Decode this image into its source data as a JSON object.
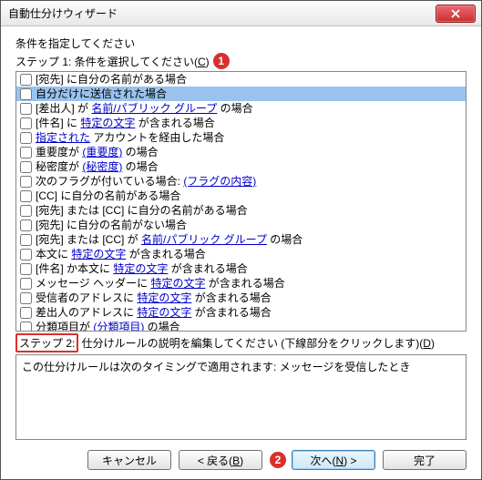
{
  "window": {
    "title": "自動仕分けウィザード"
  },
  "badges": {
    "one": "1",
    "two": "2"
  },
  "step1": {
    "prompt": "条件を指定してください",
    "line_prefix": "ステップ 1: 条件を選択してください(",
    "mnemonic": "C",
    "line_suffix": ")"
  },
  "conditions": [
    {
      "segments": [
        {
          "t": "[宛先] に自分の名前がある場合"
        }
      ],
      "checked": false,
      "selected": false
    },
    {
      "segments": [
        {
          "t": "自分だけに送信された場合"
        }
      ],
      "checked": false,
      "selected": true
    },
    {
      "segments": [
        {
          "t": "[差出人] が "
        },
        {
          "t": "名前/パブリック グループ",
          "ul": true
        },
        {
          "t": " の場合"
        }
      ],
      "checked": false
    },
    {
      "segments": [
        {
          "t": "[件名] に "
        },
        {
          "t": "特定の文字",
          "ul": true
        },
        {
          "t": " が含まれる場合"
        }
      ],
      "checked": false
    },
    {
      "segments": [
        {
          "t": "指定された",
          "ul": true
        },
        {
          "t": " アカウントを経由した場合"
        }
      ],
      "checked": false
    },
    {
      "segments": [
        {
          "t": "重要度が "
        },
        {
          "t": "(重要度)",
          "ul": true
        },
        {
          "t": " の場合"
        }
      ],
      "checked": false
    },
    {
      "segments": [
        {
          "t": "秘密度が "
        },
        {
          "t": "(秘密度)",
          "ul": true
        },
        {
          "t": " の場合"
        }
      ],
      "checked": false
    },
    {
      "segments": [
        {
          "t": "次のフラグが付いている場合: "
        },
        {
          "t": "(フラグの内容)",
          "ul": true
        }
      ],
      "checked": false
    },
    {
      "segments": [
        {
          "t": "[CC] に自分の名前がある場合"
        }
      ],
      "checked": false
    },
    {
      "segments": [
        {
          "t": "[宛先] または [CC] に自分の名前がある場合"
        }
      ],
      "checked": false
    },
    {
      "segments": [
        {
          "t": "[宛先] に自分の名前がない場合"
        }
      ],
      "checked": false
    },
    {
      "segments": [
        {
          "t": "[宛先] または [CC] が "
        },
        {
          "t": "名前/パブリック グループ",
          "ul": true
        },
        {
          "t": " の場合"
        }
      ],
      "checked": false
    },
    {
      "segments": [
        {
          "t": "本文に "
        },
        {
          "t": "特定の文字",
          "ul": true
        },
        {
          "t": " が含まれる場合"
        }
      ],
      "checked": false
    },
    {
      "segments": [
        {
          "t": "[件名] か本文に "
        },
        {
          "t": "特定の文字",
          "ul": true
        },
        {
          "t": " が含まれる場合"
        }
      ],
      "checked": false
    },
    {
      "segments": [
        {
          "t": "メッセージ ヘッダーに "
        },
        {
          "t": "特定の文字",
          "ul": true
        },
        {
          "t": " が含まれる場合"
        }
      ],
      "checked": false
    },
    {
      "segments": [
        {
          "t": "受信者のアドレスに "
        },
        {
          "t": "特定の文字",
          "ul": true
        },
        {
          "t": " が含まれる場合"
        }
      ],
      "checked": false
    },
    {
      "segments": [
        {
          "t": "差出人のアドレスに "
        },
        {
          "t": "特定の文字",
          "ul": true
        },
        {
          "t": " が含まれる場合"
        }
      ],
      "checked": false
    },
    {
      "segments": [
        {
          "t": "分類項目が "
        },
        {
          "t": "(分類項目)",
          "ul": true
        },
        {
          "t": " の場合"
        }
      ],
      "checked": false
    }
  ],
  "step2": {
    "boxed_text": "ステップ 2:",
    "line_rest": " 仕分けルールの説明を編集してください (下線部分をクリックします)(",
    "mnemonic": "D",
    "line_suffix": ")"
  },
  "description": {
    "text": "この仕分けルールは次のタイミングで適用されます: メッセージを受信したとき"
  },
  "buttons": {
    "cancel": "キャンセル",
    "back_prefix": "< 戻る(",
    "back_mnemonic": "B",
    "back_suffix": ")",
    "next_prefix": "次へ(",
    "next_mnemonic": "N",
    "next_suffix": ") >",
    "finish": "完了"
  }
}
